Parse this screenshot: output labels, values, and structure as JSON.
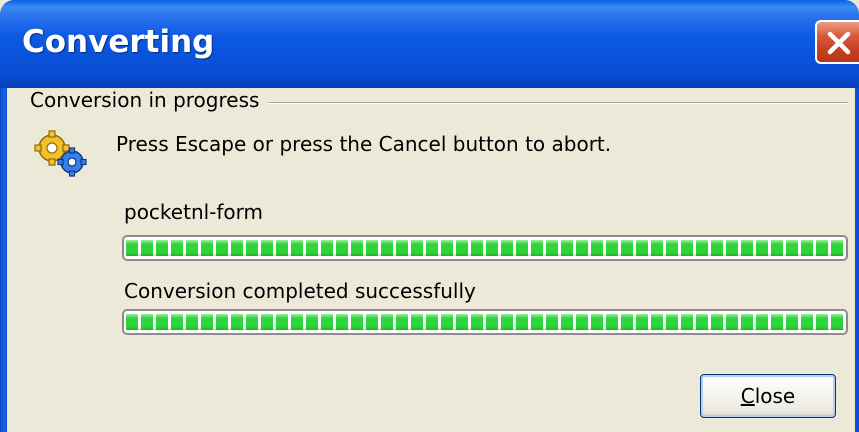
{
  "window": {
    "title": "Converting"
  },
  "group": {
    "label": "Conversion in progress"
  },
  "instruction": "Press Escape or press the Cancel button to abort.",
  "tasks": [
    {
      "label": "pocketnl-form",
      "progress_percent": 100
    },
    {
      "label": "Conversion completed successfully",
      "progress_percent": 100
    }
  ],
  "buttons": {
    "close_label_accel": "C",
    "close_label_rest": "lose"
  },
  "icons": {
    "window_close": "close-icon",
    "converting": "gears-icon"
  },
  "colors": {
    "titlebar": "#0a54dc",
    "progress_fill": "#2dd43a",
    "close_button": "#d9593a",
    "background": "#ece9d8"
  }
}
